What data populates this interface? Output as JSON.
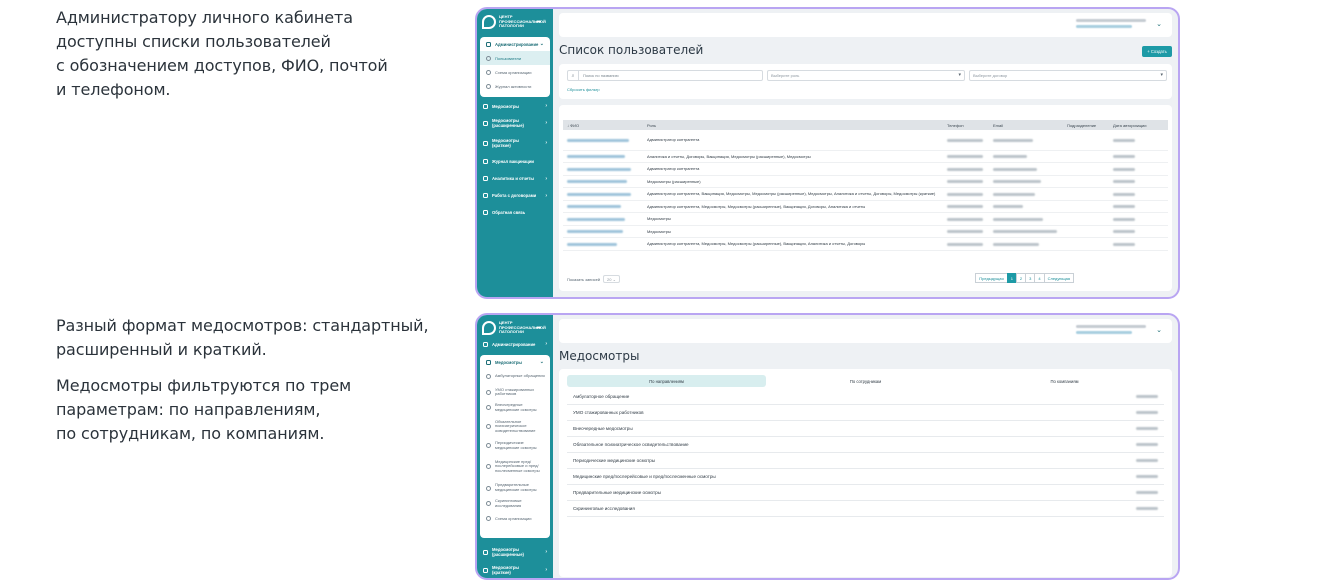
{
  "captions": {
    "block1": [
      "Администратору личного кабинета",
      "доступны списки пользователей",
      "с обозначением доступов, ФИО, почтой",
      "и телефоном."
    ],
    "block2": [
      "Разный формат медосмотров: стандартный,",
      "расширенный и краткий."
    ],
    "block3": [
      "Медосмотры фильтруются по трем",
      "параметрам: по направлениям,",
      "по сотрудникам, по компаниям."
    ]
  },
  "logo": {
    "text": "ЦЕНТР ПРОФЕССИОНАЛЬНОЙ ПАТОЛОГИИ",
    "dots": "•••"
  },
  "screen1": {
    "sidebar": {
      "group": "Администрирование",
      "subitems": [
        "Пользователи",
        "Схема организации",
        "Журнал активности"
      ],
      "items": [
        "Медосмотры",
        "Медосмотры (расширенные)",
        "Медосмотры (краткие)",
        "Журнал вакцинации",
        "Аналитика и отчеты",
        "Работа с договорами",
        "Обратная связь"
      ]
    },
    "title": "Список пользователей",
    "create_label": "+ Создать",
    "search_placeholder": "Поиск по названию",
    "role_placeholder": "Выберите роль",
    "contract_placeholder": "Выберите договор",
    "reset_label": "Сбросить фильтр",
    "columns": [
      "↓ ФИО",
      "Роль",
      "Телефон",
      "Email",
      "Подразделение",
      "Дата авторизации"
    ],
    "rows": [
      "Администратор контрагента",
      "Аналитика и отчеты, Договоры, Вакцинация, Медосмотры (расширенные), Медосмотры",
      "Администратор контрагента",
      "Медосмотры (расширенные)",
      "Администратор контрагента, Вакцинация, Медосмотры, Медосмотры (расширенные), Медосмотры, Аналитика и отчеты, Договоры, Медосмотры (краткие)",
      "Администратор контрагента, Медосмотры, Медосмотры (расширенные), Вакцинация, Договоры, Аналитика и отчеты",
      "Медосмотры",
      "Медосмотры",
      "Администратор контрагента, Медосмотры, Медосмотры (расширенные), Вакцинация, Аналитика и отчеты, Договоры"
    ],
    "per_page_label": "Показать записей",
    "per_page_value": "20",
    "pager": {
      "prev": "Предыдущая",
      "pages": [
        "1",
        "2",
        "3",
        "4"
      ],
      "next": "Следующая"
    }
  },
  "screen2": {
    "sidebar": {
      "top_item": "Администрирование",
      "group": "Медосмотры",
      "subitems": [
        "Амбулаторные обращения",
        "УМО стажированных работников",
        "Внеочередные медицинские осмотры",
        "Обязательное психиатрическое освидетельствование",
        "Периодические медицинские осмотры",
        "Медицинские пред/послерейсовые и пред/послесменные осмотры",
        "Предварительные медицинские осмотры",
        "Скрининговые исследования",
        "Схема организации"
      ],
      "bottom_items": [
        "Медосмотры (расширенные)",
        "Медосмотры (краткие)"
      ]
    },
    "title": "Медосмотры",
    "tabs": [
      "По направлениям",
      "По сотрудникам",
      "По компаниям"
    ],
    "rows": [
      "Амбулаторное обращение",
      "УМО стажированных работников",
      "Внеочередные медосмотры",
      "Обязательное психиатрическое освидетельствование",
      "Периодические медицинские осмотры",
      "Медицинские пред/послерейсовые и пред/послесменные осмотры",
      "Предварительные медицинские осмотры",
      "Скрининговые исследования"
    ]
  },
  "colors": {
    "accent": "#1d8f9a",
    "frame": "#b9a5f2",
    "background": "#eef1f4"
  }
}
